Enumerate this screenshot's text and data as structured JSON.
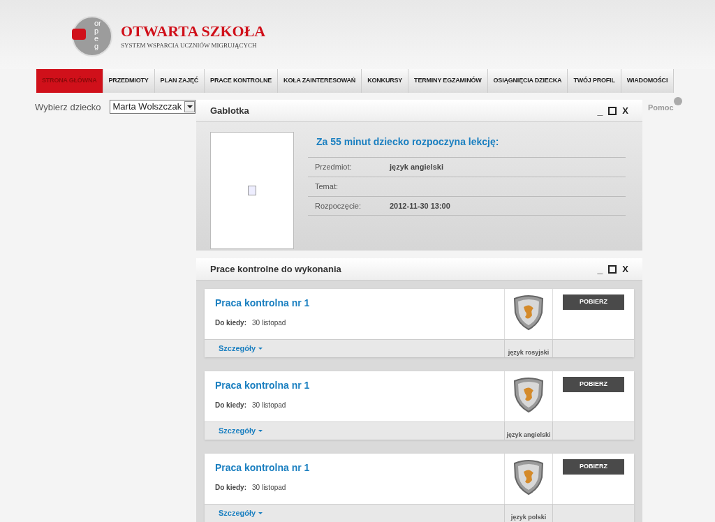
{
  "logo": {
    "mark": "orpeg",
    "title": "OTWARTA SZKOŁA",
    "subtitle": "SYSTEM WSPARCIA UCZNIÓW MIGRUJĄCYCH"
  },
  "nav": [
    {
      "label": "STRONA GŁÓWNA",
      "selected": true
    },
    {
      "label": "PRZEDMIOTY",
      "selected": false
    },
    {
      "label": "PLAN ZAJĘĆ",
      "selected": false
    },
    {
      "label": "PRACE KONTROLNE",
      "selected": false
    },
    {
      "label": "KOŁA ZAINTERESOWAŃ",
      "selected": false
    },
    {
      "label": "KONKURSY",
      "selected": false
    },
    {
      "label": "TERMINY EGZAMINÓW",
      "selected": false
    },
    {
      "label": "OSIĄGNIĘCIA DZIECKA",
      "selected": false
    },
    {
      "label": "TWÓJ PROFIL",
      "selected": false
    },
    {
      "label": "WIADOMOŚCI",
      "selected": false
    }
  ],
  "child_select": {
    "label": "Wybierz dziecko",
    "value": "Marta Wolszczak"
  },
  "help": "Pomoc",
  "panels": [
    {
      "title": "Gablotka",
      "controls": [
        "_",
        "X"
      ],
      "heading": "Za 55 minut dziecko rozpoczyna lekcję:",
      "rows": [
        {
          "label": "Przedmiot:",
          "value": "język angielski"
        },
        {
          "label": "Temat:"
        },
        {
          "label": "Rozpoczęcie:",
          "value": "2012-11-30 13:00"
        }
      ]
    },
    {
      "title": "Prace kontrolne do wykonania",
      "controls": [
        "_",
        "X"
      ],
      "cards": [
        {
          "title": "Praca kontrolna nr 1",
          "due_label": "Do kiedy:",
          "due": "30 listopad",
          "subject": "język rosyjski",
          "button": "POBIERZ",
          "details": "Szczegóły"
        },
        {
          "title": "Praca kontrolna nr 1",
          "due_label": "Do kiedy:",
          "due": "30 listopad",
          "subject": "język angielski",
          "button": "POBIERZ",
          "details": "Szczegóły"
        },
        {
          "title": "Praca kontrolna nr 1",
          "due_label": "Do kiedy:",
          "due": "30 listopad",
          "subject": "język polski",
          "button": "POBIERZ",
          "details": "Szczegóły"
        }
      ]
    }
  ]
}
